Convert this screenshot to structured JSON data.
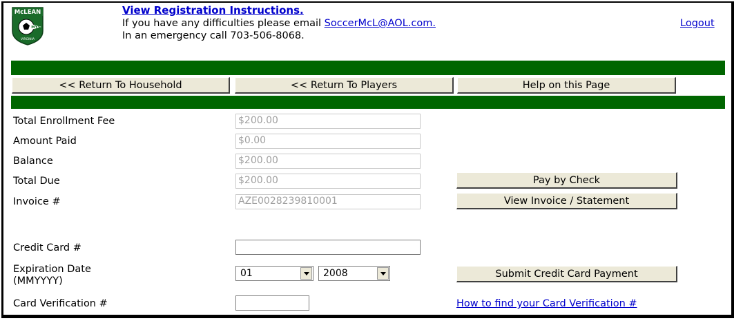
{
  "header": {
    "logo_text_top": "McLEAN",
    "logo_text_mid": "MYS",
    "logo_text_bottom": "VIRGINIA",
    "instructions_link": "View Registration Instructions.",
    "difficulty_text": "If you have any difficulties please email ",
    "email_link": "SoccerMcL@AOL.com.",
    "emergency_text": "In an emergency call 703-506-8068.",
    "logout_link": "Logout"
  },
  "nav": {
    "return_household": "<< Return To Household",
    "return_players": "<< Return To Players",
    "help": "Help on this Page"
  },
  "summary": {
    "total_enrollment_label": "Total Enrollment Fee",
    "total_enrollment_value": "$200.00",
    "amount_paid_label": "Amount Paid",
    "amount_paid_value": "$0.00",
    "balance_label": "Balance",
    "balance_value": "$200.00",
    "total_due_label": "Total Due",
    "total_due_value": "$200.00",
    "invoice_label": "Invoice #",
    "invoice_value": "AZE0028239810001"
  },
  "actions": {
    "pay_by_check": "Pay by Check",
    "view_invoice": "View Invoice / Statement",
    "submit_cc": "Submit Credit Card Payment"
  },
  "payment": {
    "cc_label": "Credit Card #",
    "cc_value": "",
    "exp_label_line1": "Expiration Date",
    "exp_label_line2": "(MMYYYY)",
    "exp_month": "01",
    "exp_year": "2008",
    "cvv_label": "Card Verification #",
    "cvv_value": "",
    "cvv_help_link": "How to find your Card Verification #"
  },
  "colors": {
    "brand_green": "#006600",
    "link_blue": "#0000cc",
    "button_face": "#ece9d8"
  }
}
